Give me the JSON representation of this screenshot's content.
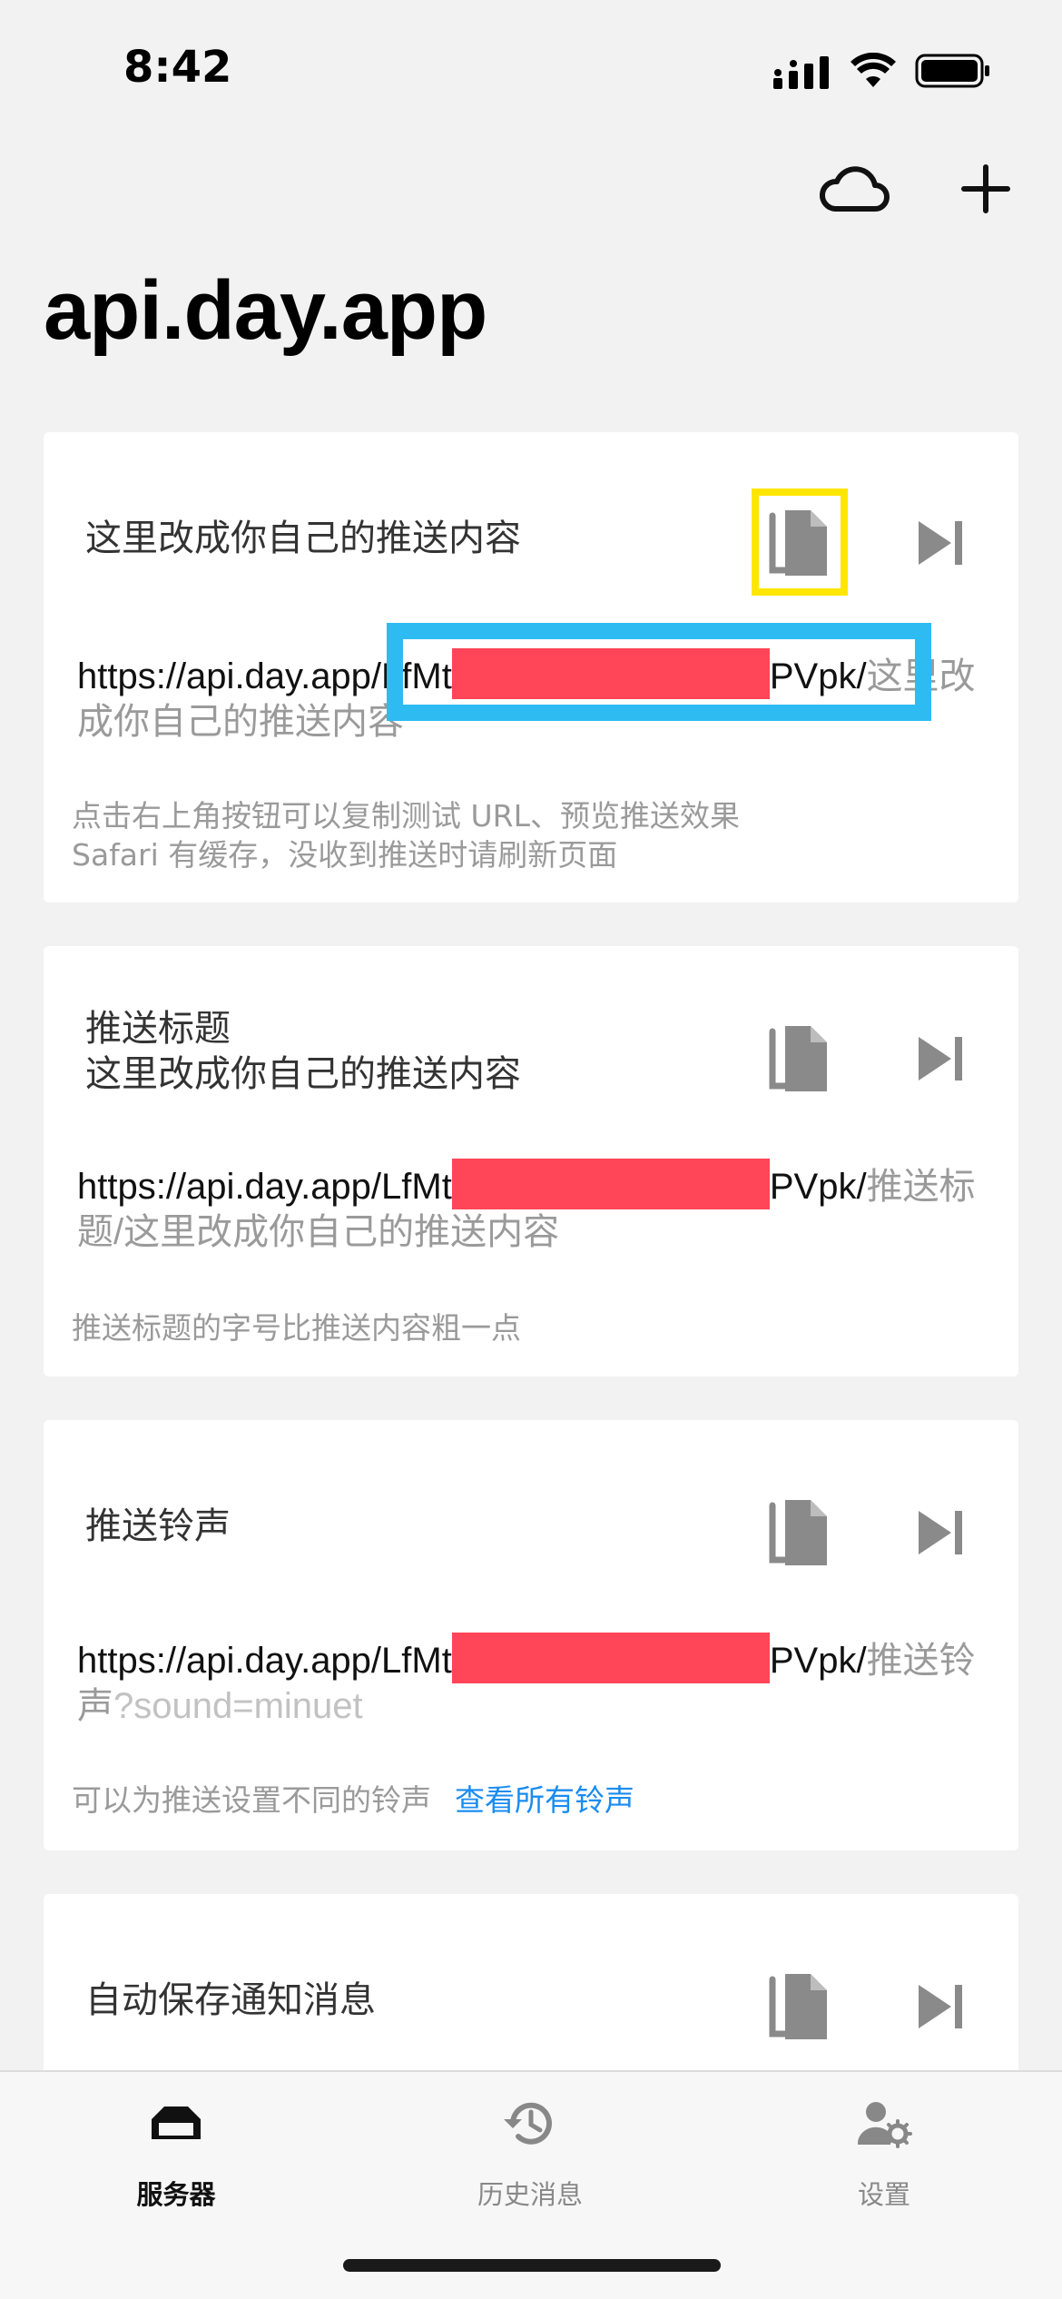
{
  "status_bar": {
    "time": "8:42"
  },
  "header": {
    "title": "api.day.app"
  },
  "cards": [
    {
      "heading_line1": "这里改成你自己的推送内容",
      "url_prefix": "https://api.day.app/LfMt",
      "url_key_suffix": "PVpk/",
      "url_path": "这里改成你自己的推送内容",
      "hint_line1": "点击右上角按钮可以复制测试 URL、预览推送效果",
      "hint_line2": "Safari 有缓存，没收到推送时请刷新页面"
    },
    {
      "heading_line1": "推送标题",
      "heading_line2": "这里改成你自己的推送内容",
      "url_prefix": "https://api.day.app/LfMt",
      "url_key_suffix": "PVpk/",
      "url_path": "推送标题/这里改成你自己的推送内容",
      "hint_line1": "推送标题的字号比推送内容粗一点"
    },
    {
      "heading_line1": "推送铃声",
      "url_prefix": "https://api.day.app/LfMt",
      "url_key_suffix": "PVpk/",
      "url_path": "推送铃声",
      "url_query": "?sound=minuet",
      "hint_line1": "可以为推送设置不同的铃声",
      "hint_link": "查看所有铃声"
    },
    {
      "heading_line1": "自动保存通知消息"
    }
  ],
  "tabbar": {
    "items": [
      {
        "label": "服务器",
        "icon": "server-icon",
        "active": true
      },
      {
        "label": "历史消息",
        "icon": "history-icon",
        "active": false
      },
      {
        "label": "设置",
        "icon": "settings-icon",
        "active": false
      }
    ]
  },
  "colors": {
    "background": "#f2f2f2",
    "card": "#ffffff",
    "link": "#1a8cf0",
    "redaction": "#ff4557",
    "highlight_yellow": "#ffe600",
    "highlight_blue": "#2ebbf2"
  }
}
